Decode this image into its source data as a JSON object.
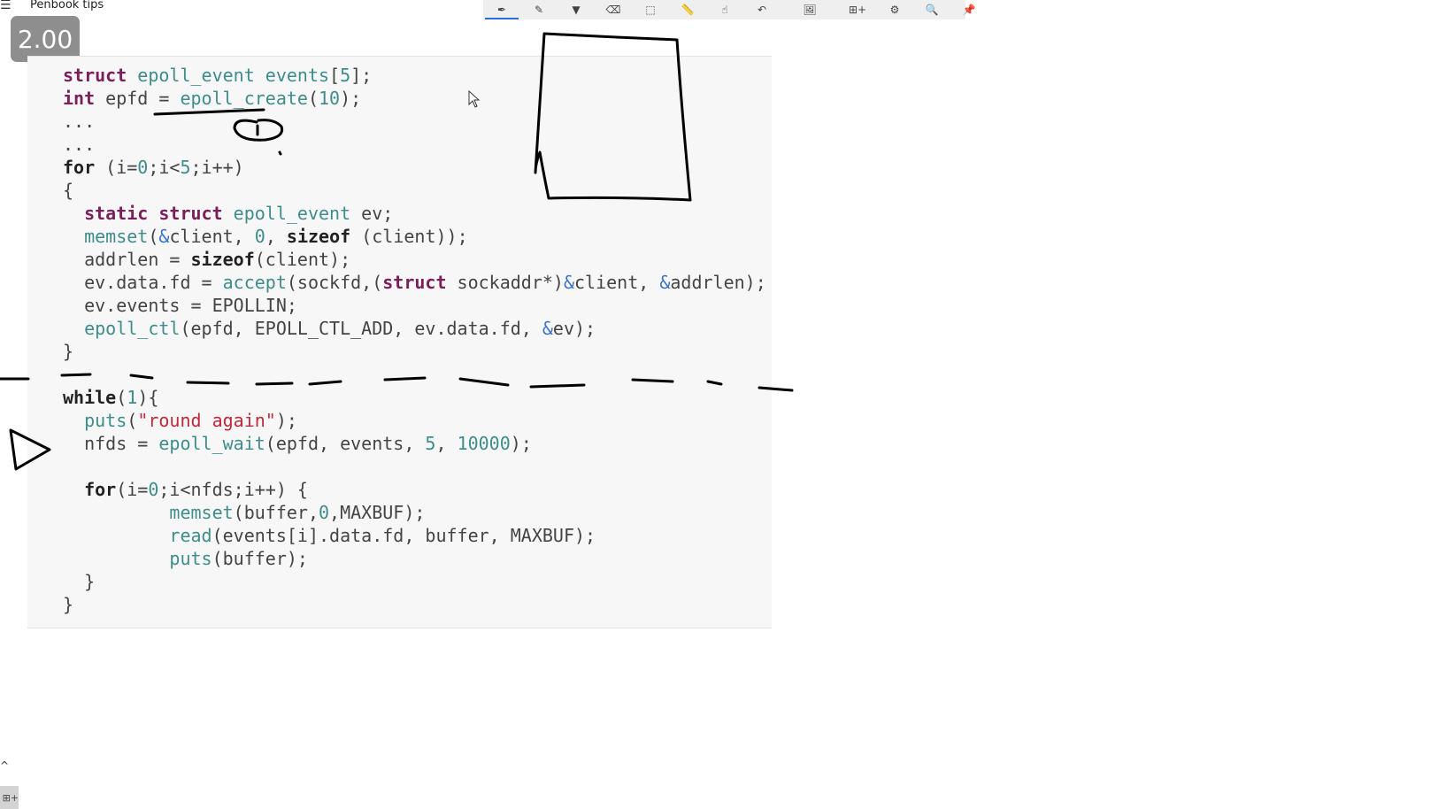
{
  "window": {
    "menu_icon": "hamburger-menu-icon",
    "title": "Penbook tips",
    "zoom_level": "2.00"
  },
  "toolbar": {
    "tools": [
      {
        "icon": "pen-icon",
        "glyph": "✒",
        "active": true
      },
      {
        "icon": "pencil-icon",
        "glyph": "✎",
        "active": false
      },
      {
        "icon": "highlighter-icon",
        "glyph": "▼",
        "active": false
      },
      {
        "icon": "eraser-icon",
        "glyph": "⌫",
        "active": false
      },
      {
        "icon": "lasso-select-icon",
        "glyph": "⬚",
        "active": false
      },
      {
        "icon": "ruler-icon",
        "glyph": "📏",
        "active": false
      },
      {
        "icon": "touch-pan-icon",
        "glyph": "☝",
        "active": false
      },
      {
        "icon": "undo-icon",
        "glyph": "↶",
        "active": false
      },
      {
        "icon": "insert-image-icon",
        "glyph": "🖼",
        "active": false
      },
      {
        "icon": "add-page-icon",
        "glyph": "⊞+",
        "active": false
      },
      {
        "icon": "settings-gear-icon",
        "glyph": "⚙",
        "active": false
      },
      {
        "icon": "search-icon",
        "glyph": "🔍",
        "active": false
      },
      {
        "icon": "pin-icon",
        "glyph": "📌",
        "active": false
      }
    ]
  },
  "code": {
    "lines": [
      [
        {
          "t": "struct",
          "c": "kw"
        },
        {
          "t": " "
        },
        {
          "t": "epoll_event",
          "c": "ty"
        },
        {
          "t": " "
        },
        {
          "t": "events",
          "c": "ty"
        },
        {
          "t": "["
        },
        {
          "t": "5",
          "c": "num"
        },
        {
          "t": "];"
        }
      ],
      [
        {
          "t": "int",
          "c": "kw"
        },
        {
          "t": " epfd = "
        },
        {
          "t": "epoll_create",
          "c": "fn"
        },
        {
          "t": "("
        },
        {
          "t": "10",
          "c": "num"
        },
        {
          "t": ");"
        }
      ],
      [
        {
          "t": "..."
        }
      ],
      [
        {
          "t": "..."
        }
      ],
      [
        {
          "t": "for",
          "c": "kw2"
        },
        {
          "t": " (i="
        },
        {
          "t": "0",
          "c": "num"
        },
        {
          "t": ";i<"
        },
        {
          "t": "5",
          "c": "num"
        },
        {
          "t": ";i++)"
        }
      ],
      [
        {
          "t": "{"
        }
      ],
      [
        {
          "t": "  static",
          "c": "kw"
        },
        {
          "t": " "
        },
        {
          "t": "struct",
          "c": "kw"
        },
        {
          "t": " "
        },
        {
          "t": "epoll_event",
          "c": "ty"
        },
        {
          "t": " ev;"
        }
      ],
      [
        {
          "t": "  "
        },
        {
          "t": "memset",
          "c": "fn"
        },
        {
          "t": "("
        },
        {
          "t": "&",
          "c": "op"
        },
        {
          "t": "client, "
        },
        {
          "t": "0",
          "c": "num"
        },
        {
          "t": ", "
        },
        {
          "t": "sizeof",
          "c": "kw2"
        },
        {
          "t": " (client));"
        }
      ],
      [
        {
          "t": "  addrlen = "
        },
        {
          "t": "sizeof",
          "c": "kw2"
        },
        {
          "t": "(client);"
        }
      ],
      [
        {
          "t": "  ev.data.fd = "
        },
        {
          "t": "accept",
          "c": "fn"
        },
        {
          "t": "(sockfd,("
        },
        {
          "t": "struct",
          "c": "kw"
        },
        {
          "t": " sockaddr*)"
        },
        {
          "t": "&",
          "c": "op"
        },
        {
          "t": "client, "
        },
        {
          "t": "&",
          "c": "op"
        },
        {
          "t": "addrlen);"
        }
      ],
      [
        {
          "t": "  ev.events = EPOLLIN;"
        }
      ],
      [
        {
          "t": "  "
        },
        {
          "t": "epoll_ctl",
          "c": "fn"
        },
        {
          "t": "(epfd, EPOLL_CTL_ADD, ev.data.fd, "
        },
        {
          "t": "&",
          "c": "op"
        },
        {
          "t": "ev);"
        }
      ],
      [
        {
          "t": "}"
        }
      ],
      [
        {
          "t": ""
        }
      ],
      [
        {
          "t": "while",
          "c": "kw2"
        },
        {
          "t": "("
        },
        {
          "t": "1",
          "c": "num"
        },
        {
          "t": "){"
        }
      ],
      [
        {
          "t": "  "
        },
        {
          "t": "puts",
          "c": "fn"
        },
        {
          "t": "("
        },
        {
          "t": "\"round again\"",
          "c": "str"
        },
        {
          "t": ");"
        }
      ],
      [
        {
          "t": "  nfds = "
        },
        {
          "t": "epoll_wait",
          "c": "fn"
        },
        {
          "t": "(epfd, events, "
        },
        {
          "t": "5",
          "c": "num"
        },
        {
          "t": ", "
        },
        {
          "t": "10000",
          "c": "num"
        },
        {
          "t": ");"
        }
      ],
      [
        {
          "t": ""
        }
      ],
      [
        {
          "t": "  "
        },
        {
          "t": "for",
          "c": "kw2"
        },
        {
          "t": "(i="
        },
        {
          "t": "0",
          "c": "num"
        },
        {
          "t": ";i<nfds;i++) {"
        }
      ],
      [
        {
          "t": "          "
        },
        {
          "t": "memset",
          "c": "fn"
        },
        {
          "t": "(buffer,"
        },
        {
          "t": "0",
          "c": "num"
        },
        {
          "t": ",MAXBUF);"
        }
      ],
      [
        {
          "t": "          "
        },
        {
          "t": "read",
          "c": "fn"
        },
        {
          "t": "(events[i].data.fd, buffer, MAXBUF);"
        }
      ],
      [
        {
          "t": "          "
        },
        {
          "t": "puts",
          "c": "fn"
        },
        {
          "t": "(buffer);"
        }
      ],
      [
        {
          "t": "  }"
        }
      ],
      [
        {
          "t": "}"
        }
      ]
    ]
  },
  "colors": {
    "keyword": "#7a1f5a",
    "type_function": "#3f8c8c",
    "string": "#c0283a",
    "operator": "#3a72c7",
    "ink": "#000000",
    "toolbar_active": "#2b6fd6"
  },
  "annotations": [
    {
      "kind": "ink-underline",
      "target": "epoll_create"
    },
    {
      "kind": "ink-scribble-circle",
      "target": "epoll_create"
    },
    {
      "kind": "ink-rectangle"
    },
    {
      "kind": "ink-dashed-separator"
    },
    {
      "kind": "ink-play-arrow",
      "target": "epoll_wait line"
    }
  ],
  "footer": {
    "scroll_up_icon": "chevron-up-icon",
    "corner_button_label": "⊞+",
    "corner_button_icon": "add-page-icon"
  }
}
